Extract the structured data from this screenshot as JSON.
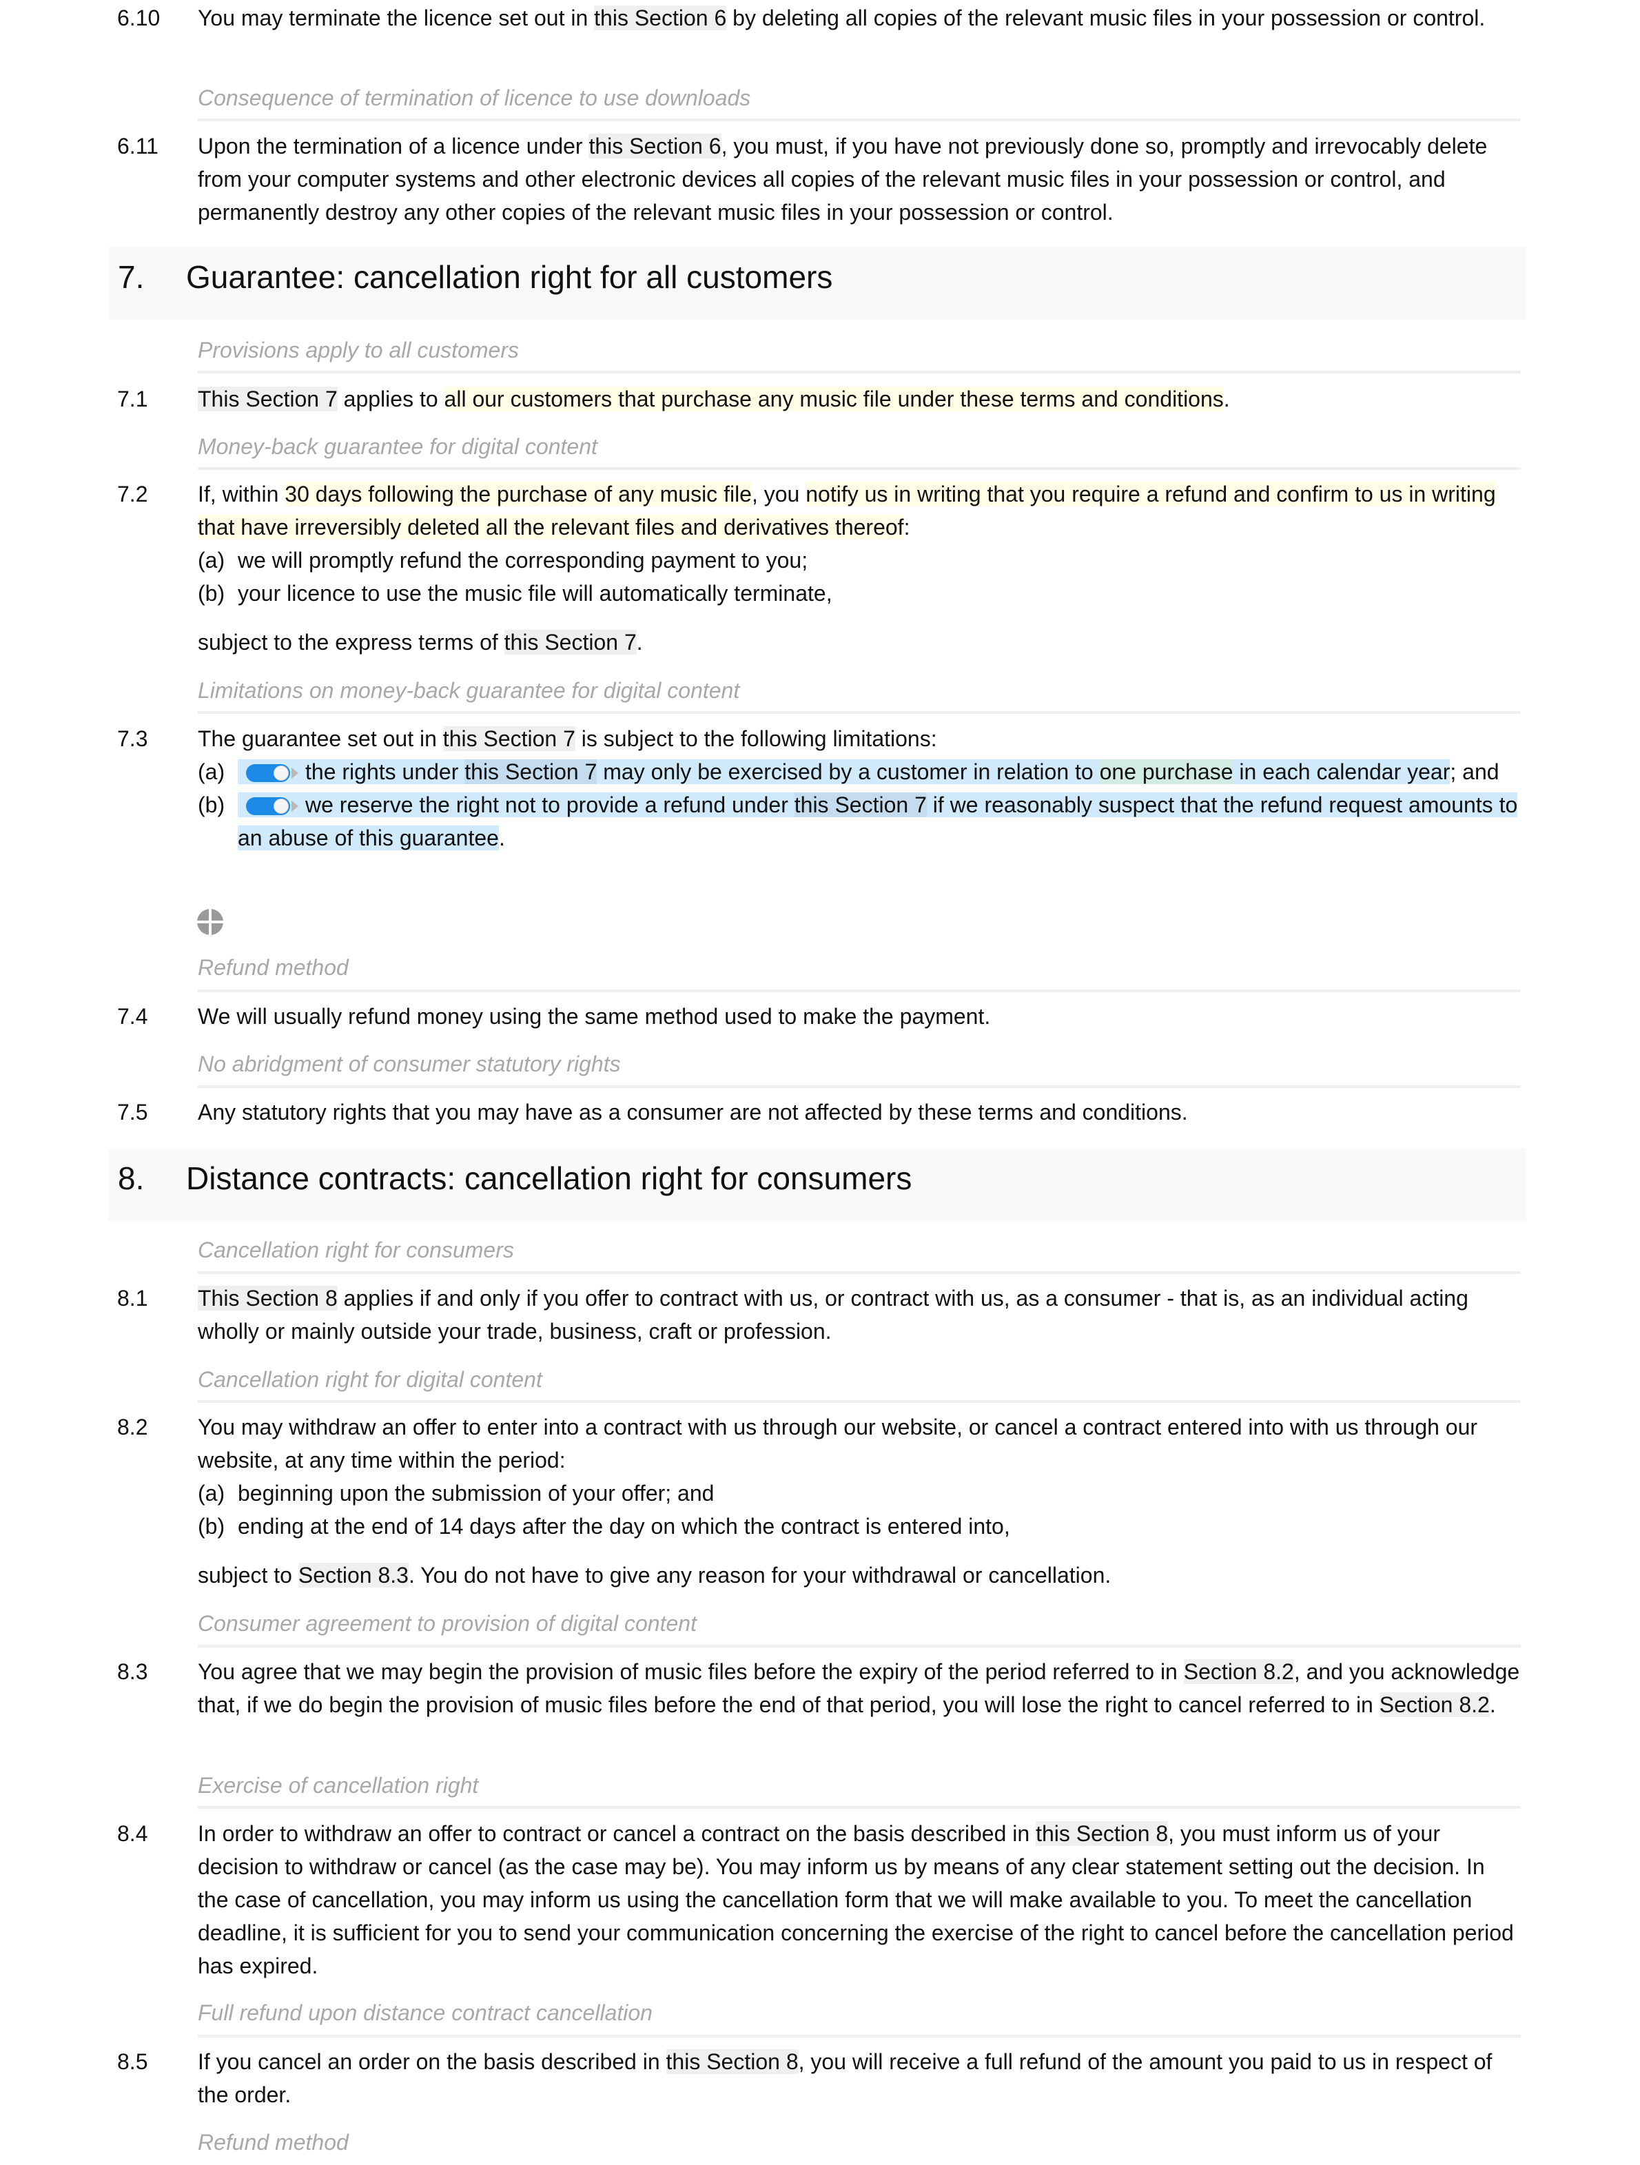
{
  "clauses": {
    "c610": {
      "num": "6.10",
      "t1": "You may terminate the licence set out in ",
      "x1": "this Section 6",
      "t2": " by deleting all copies of the relevant music files in your possession or control."
    },
    "g611": "Consequence of termination of licence to use downloads",
    "c611": {
      "num": "6.11",
      "t1": "Upon the termination of a licence under ",
      "x1": "this Section 6",
      "t2": ", you must, if you have not previously done so, promptly and irrevocably delete from your computer systems and other electronic devices all copies of the relevant music files in your possession or control, and permanently destroy any other copies of the relevant music files in your possession or control."
    },
    "h7": {
      "num": "7.",
      "title": "Guarantee: cancellation right for all customers"
    },
    "g71": "Provisions apply to all customers",
    "c71": {
      "num": "7.1",
      "x1": "This Section 7",
      "t1": " applies to ",
      "v1": "all our customers that purchase any music file under these terms and conditions",
      "t2": "."
    },
    "g72": "Money-back guarantee for digital content",
    "c72": {
      "num": "7.2",
      "t1": "If, within ",
      "v1": "30 days following the purchase of any music file",
      "t2": ", you ",
      "v2": "notify us in writing that you require a refund and confirm to us in writing that have irreversibly deleted all the relevant files and derivatives thereof",
      "t3": ":",
      "a_label": "(a)",
      "a_text": "we will promptly refund the corresponding payment to you;",
      "b_label": "(b)",
      "b_text": "your licence to use the music file will automatically terminate,",
      "tail1": "subject to the express terms of ",
      "tailx": "this Section 7",
      "tail2": "."
    },
    "g73": "Limitations on money-back guarantee for digital content",
    "c73": {
      "num": "7.3",
      "t1": "The guarantee set out in ",
      "x1": "this Section 7",
      "t2": " is subject to the following limitations:",
      "a_label": "(a)",
      "a_t1": "the rights under ",
      "a_x": "this Section 7",
      "a_t2": " may only be exercised by a customer in relation to ",
      "a_v": "one purchase",
      "a_t3": " in each calendar year",
      "a_t4": "; and",
      "a_toggle_on": true,
      "b_label": "(b)",
      "b_t1": "we reserve the right not to provide a refund under ",
      "b_x": "this Section 7",
      "b_t2": " if we reasonably suspect that the refund request amounts to an abuse of this guarantee",
      "b_t3": ".",
      "b_toggle_on": true
    },
    "g74": "Refund method",
    "c74": {
      "num": "7.4",
      "text": "We will usually refund money using the same method used to make the payment."
    },
    "g75": "No abridgment of consumer statutory rights",
    "c75": {
      "num": "7.5",
      "text": "Any statutory rights that you may have as a consumer are not affected by these terms and conditions."
    },
    "h8": {
      "num": "8.",
      "title": "Distance contracts: cancellation right for consumers"
    },
    "g81": "Cancellation right for consumers",
    "c81": {
      "num": "8.1",
      "x1": "This Section 8",
      "t1": " applies if and only if you offer to contract with us, or contract with us, as a consumer - that is, as an individual acting wholly or mainly outside your trade, business, craft or profession."
    },
    "g82": "Cancellation right for digital content",
    "c82": {
      "num": "8.2",
      "t1": "You may withdraw an offer to enter into a contract with us through our website, or cancel a contract entered into with us through our website, at any time within the period:",
      "a_label": "(a)",
      "a_text": "beginning upon the submission of your offer; and",
      "b_label": "(b)",
      "b_text": "ending at the end of 14 days after the day on which the contract is entered into,",
      "tail1": "subject to ",
      "tailx": "Section 8.3",
      "tail2": ". You do not have to give any reason for your withdrawal or cancellation."
    },
    "g83": "Consumer agreement to provision of digital content",
    "c83": {
      "num": "8.3",
      "t1": "You agree that we may begin the provision of music files before the expiry of the period referred to in ",
      "x1": "Section 8.2",
      "t2": ", and you acknowledge that, if we do begin the provision of music files before the end of that period, you will lose the right to cancel referred to in ",
      "x2": "Section 8.2",
      "t3": "."
    },
    "g84": "Exercise of cancellation right",
    "c84": {
      "num": "8.4",
      "t1": "In order to withdraw an offer to contract or cancel a contract on the basis described in ",
      "x1": "this Section 8",
      "t2": ", you must inform us of your decision to withdraw or cancel (as the case may be). You may inform us by means of any clear statement setting out the decision. In the case of cancellation, you may inform us using the cancellation form that we will make available to you. To meet the cancellation deadline, it is sufficient for you to send your communication concerning the exercise of the right to cancel before the cancellation period has expired."
    },
    "g85": "Full refund upon distance contract cancellation",
    "c85": {
      "num": "8.5",
      "t1": "If you cancel an order on the basis described in ",
      "x1": "this Section 8",
      "t2": ", you will receive a full refund of the amount you paid to us in respect of the order."
    },
    "g86": "Refund method"
  },
  "colors": {
    "variable_highlight": "#fefde6",
    "option_highlight": "#d0e9fb",
    "xref_highlight": "#efefef",
    "toggle_on": "#1a8ae6",
    "guide_text": "#a8a8a8"
  }
}
